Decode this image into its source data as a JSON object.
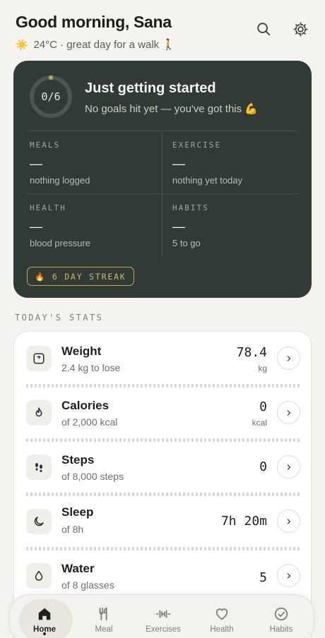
{
  "header": {
    "greeting": "Good morning, Sana",
    "weather": "24°C · great day for a walk 🚶"
  },
  "summary": {
    "ring_text": "0/6",
    "progress": 0,
    "title": "Just getting started",
    "subtitle": "No goals hit yet — you've got this 💪",
    "cells": [
      {
        "label": "MEALS",
        "value": "—",
        "sub": "nothing logged"
      },
      {
        "label": "EXERCISE",
        "value": "—",
        "sub": "nothing yet today"
      },
      {
        "label": "HEALTH",
        "value": "—",
        "sub": "blood pressure"
      },
      {
        "label": "HABITS",
        "value": "—",
        "sub": "5 to go"
      }
    ],
    "streak": "🔥 6 DAY STREAK"
  },
  "stats_section": {
    "label": "TODAY'S STATS"
  },
  "stats": [
    {
      "name": "Weight",
      "sub": "2.4 kg to lose",
      "value": "78.4",
      "unit": "kg",
      "icon": "scale-icon"
    },
    {
      "name": "Calories",
      "sub": "of 2,000 kcal",
      "value": "0",
      "unit": "kcal",
      "icon": "flame-icon"
    },
    {
      "name": "Steps",
      "sub": "of 8,000 steps",
      "value": "0",
      "unit": "",
      "icon": "footsteps-icon"
    },
    {
      "name": "Sleep",
      "sub": "of 8h",
      "value": "7h 20m",
      "unit": "",
      "icon": "moon-icon"
    },
    {
      "name": "Water",
      "sub": "of 8 glasses",
      "value": "5",
      "unit": "",
      "icon": "droplet-icon"
    }
  ],
  "nav": {
    "items": [
      {
        "label": "Home",
        "icon": "home-icon",
        "active": true
      },
      {
        "label": "Meal",
        "icon": "fork-knife-icon"
      },
      {
        "label": "Exercises",
        "icon": "dumbbell-icon"
      },
      {
        "label": "Health",
        "icon": "heart-icon"
      },
      {
        "label": "Habits",
        "icon": "check-circle-icon"
      }
    ]
  },
  "colors": {
    "background": "#f5f3ee",
    "summary_card": "#2f3b34",
    "streak_accent": "#c9a35a"
  }
}
